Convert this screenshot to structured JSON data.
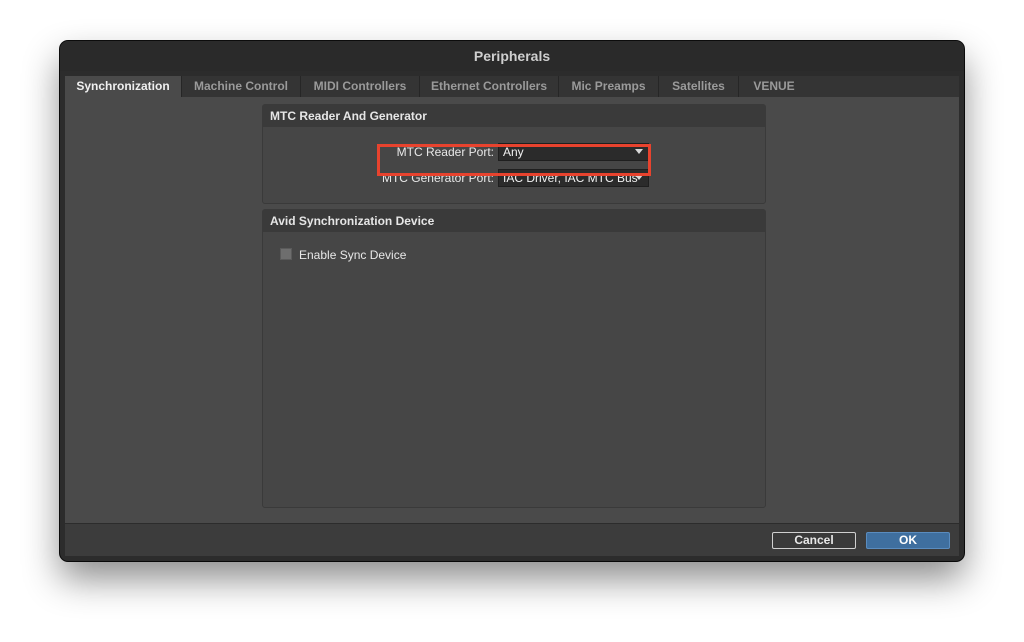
{
  "window": {
    "title": "Peripherals"
  },
  "tabs": [
    {
      "label": "Synchronization",
      "active": true
    },
    {
      "label": "Machine Control"
    },
    {
      "label": "MIDI Controllers"
    },
    {
      "label": "Ethernet Controllers"
    },
    {
      "label": "Mic Preamps"
    },
    {
      "label": "Satellites"
    },
    {
      "label": "VENUE"
    }
  ],
  "mtc_panel": {
    "title": "MTC Reader And Generator",
    "reader_label": "MTC Reader Port:",
    "reader_value": "Any",
    "generator_label": "MTC Generator Port:",
    "generator_value": "IAC Driver, IAC MTC Bus"
  },
  "sync_panel": {
    "title": "Avid Synchronization Device",
    "checkbox_label": "Enable Sync Device",
    "checkbox_checked": false
  },
  "buttons": {
    "cancel": "Cancel",
    "ok": "OK"
  },
  "colors": {
    "highlight": "#e8432e",
    "ok_button": "#3f6f9f"
  }
}
